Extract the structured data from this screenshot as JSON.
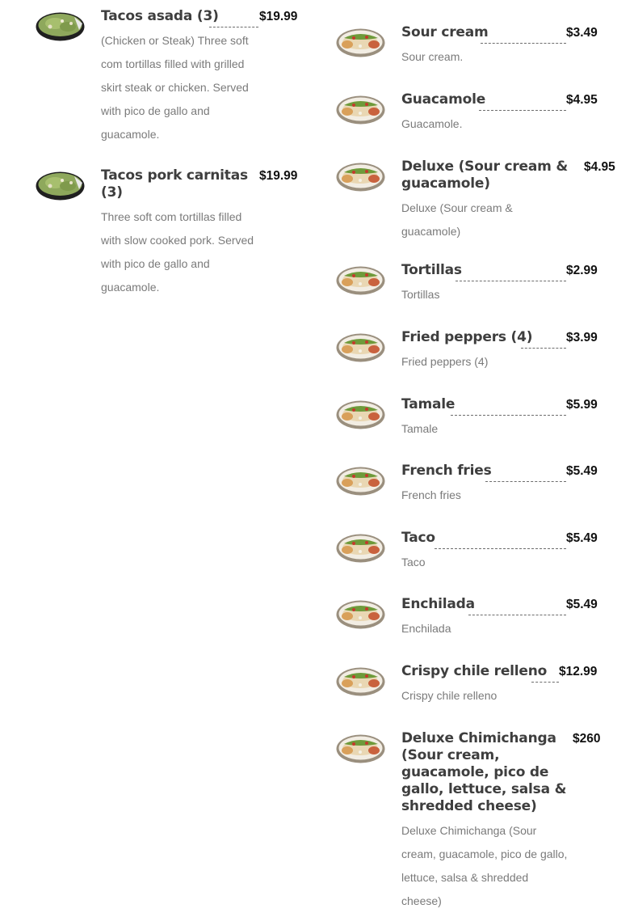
{
  "left_items": [
    {
      "name": "Tacos asada (3)",
      "price": "$19.99",
      "description": "(Chicken or Steak) Three soft com tortillas filled with grilled skirt steak or chicken. Served with pico de gallo and guacamole.",
      "image_icon": "taco-bowl-image"
    },
    {
      "name": "Tacos pork carnitas (3)",
      "price": "$19.99",
      "description": "Three soft com tortillas filled with slow cooked pork. Served with pico de gallo and guacamole.",
      "image_icon": "taco-bowl-image"
    }
  ],
  "right_items": [
    {
      "name": "Sour cream",
      "price": "$3.49",
      "description": "Sour cream.",
      "image_icon": "burrito-plate-image"
    },
    {
      "name": "Guacamole",
      "price": "$4.95",
      "description": "Guacamole.",
      "image_icon": "burrito-plate-image"
    },
    {
      "name": "Deluxe (Sour cream & guacamole)",
      "price": "$4.95",
      "description": "Deluxe (Sour cream & guacamole)",
      "image_icon": "burrito-plate-image"
    },
    {
      "name": "Tortillas",
      "price": "$2.99",
      "description": "Tortillas",
      "image_icon": "burrito-plate-image"
    },
    {
      "name": "Fried peppers (4)",
      "price": "$3.99",
      "description": "Fried peppers (4)",
      "image_icon": "burrito-plate-image"
    },
    {
      "name": "Tamale",
      "price": "$5.99",
      "description": "Tamale",
      "image_icon": "burrito-plate-image"
    },
    {
      "name": "French fries",
      "price": "$5.49",
      "description": "French fries",
      "image_icon": "burrito-plate-image"
    },
    {
      "name": "Taco",
      "price": "$5.49",
      "description": "Taco",
      "image_icon": "burrito-plate-image"
    },
    {
      "name": "Enchilada",
      "price": "$5.49",
      "description": "Enchilada",
      "image_icon": "burrito-plate-image"
    },
    {
      "name": "Crispy chile relleno",
      "price": "$12.99",
      "description": "Crispy chile relleno",
      "image_icon": "burrito-plate-image"
    },
    {
      "name": "Deluxe Chimichanga (Sour cream, guacamole, pico de gallo, lettuce, salsa & shredded cheese)",
      "price": "$260",
      "description": "Deluxe Chimichanga (Sour cream, guacamole, pico de gallo, lettuce, salsa & shredded cheese)",
      "image_icon": "burrito-plate-image"
    }
  ],
  "colors": {
    "name_text": "#3e3e3e",
    "price_text": "#111111",
    "description_text": "#7a7a7a",
    "dotted_leader": "#6d6d6d"
  }
}
